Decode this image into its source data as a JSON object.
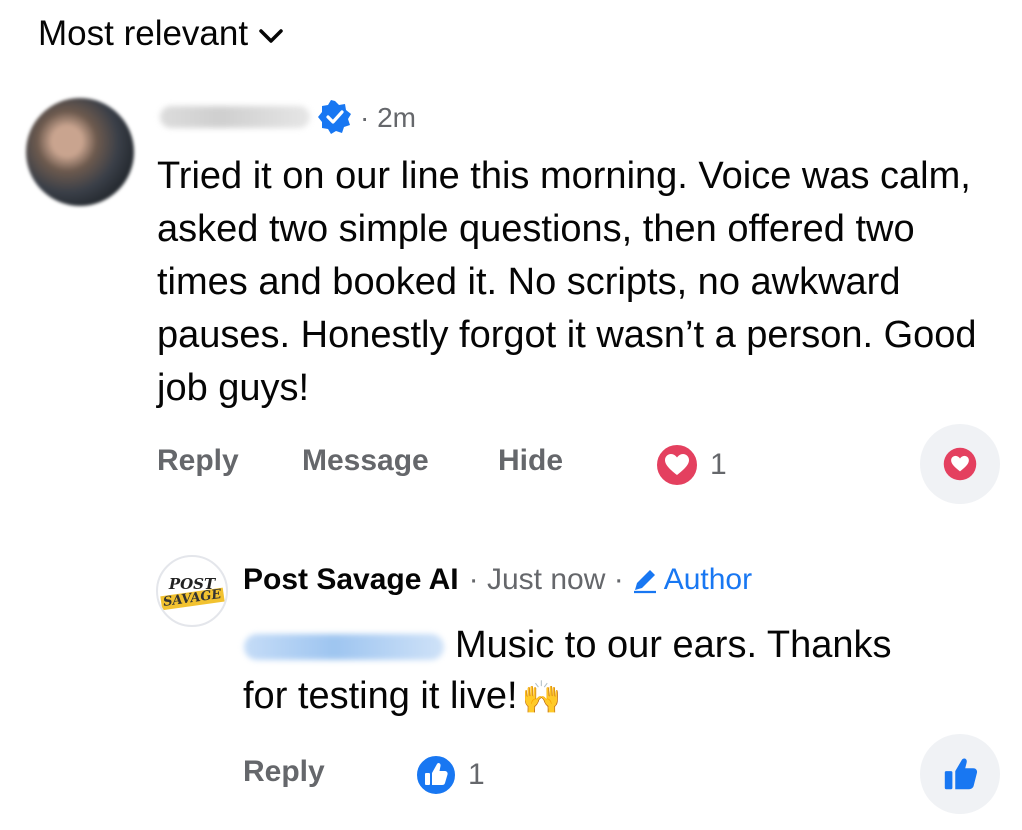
{
  "sort": {
    "label": "Most relevant"
  },
  "comment": {
    "time": "· 2m",
    "text": "Tried it on our line this morning. Voice was calm, asked two simple questions, then offered two times and booked it. No scripts, no awkward pauses. Honestly forgot it wasn’t a person. Good job guys!",
    "actions": {
      "reply": "Reply",
      "message": "Message",
      "hide": "Hide"
    },
    "reaction": {
      "icon": "love-reaction-icon",
      "count": "1"
    }
  },
  "reply": {
    "avatar": {
      "line1": "POST",
      "line2": "SAVAGE"
    },
    "name": "Post Savage AI",
    "time": "· Just now ·",
    "author_label": "Author",
    "text_line1": "Music to our ears. Thanks",
    "text_line2": "for testing it live!",
    "emoji": "🙌",
    "actions": {
      "reply": "Reply"
    },
    "reaction": {
      "icon": "like-reaction-icon",
      "count": "1"
    }
  },
  "colors": {
    "accent": "#1877f2",
    "love": "#e4405f",
    "muted": "#65676b"
  }
}
